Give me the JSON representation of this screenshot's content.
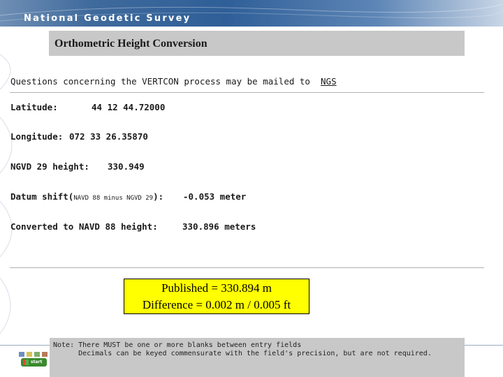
{
  "header": {
    "title": "National Geodetic Survey"
  },
  "page": {
    "title": "Orthometric Height Conversion"
  },
  "intro": {
    "text": "Questions concerning the VERTCON process may be mailed to",
    "link": "NGS"
  },
  "fields": {
    "latitude": {
      "label": "Latitude:",
      "value": "44 12 44.72000"
    },
    "longitude": {
      "label": "Longitude:",
      "value": "072 33 26.35870"
    },
    "ngvd": {
      "label": "NGVD 29 height:",
      "value": "330.949"
    },
    "datum": {
      "label": "Datum shift(",
      "sub": "NAVD 88 minus NGVD 29",
      "close": "):",
      "value": "-0.053 meter"
    },
    "converted": {
      "label": "Converted to NAVD 88 height:",
      "value": "330.896 meters"
    }
  },
  "published": {
    "line1": "Published = 330.894 m",
    "line2": "Difference = 0.002 m / 0.005 ft"
  },
  "note": {
    "line1": "Note: There MUST be one or more blanks between entry fields",
    "line2": "      Decimals can be keyed commensurate with the field's precision, but are not required."
  },
  "taskbar": {
    "start_label": "start"
  },
  "colors": {
    "header": "#2f5f98",
    "title_bg": "#c8c8c8",
    "highlight": "#ffff00"
  }
}
